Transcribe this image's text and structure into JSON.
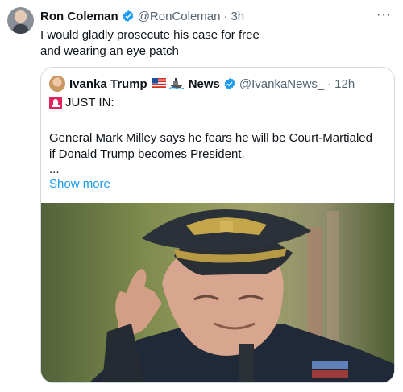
{
  "tweet": {
    "author_name": "Ron Coleman",
    "handle": "@RonColeman",
    "dot": "·",
    "time": "3h",
    "more": "···",
    "text_lines": [
      "I would gladly prosecute his case for free",
      "and wearing an eye patch"
    ]
  },
  "quote": {
    "author_name": "Ivanka Trump",
    "news_label": "News",
    "handle": "@IvankaNews_",
    "dot": "·",
    "time": "12h",
    "just_in": "JUST IN:",
    "para_lines": [
      "General Mark Milley says he fears he will be Court-Martialed",
      "if Donald Trump becomes President."
    ],
    "ellipsis": "...",
    "show_more": "Show more"
  },
  "colors": {
    "accent": "#1d9bf0",
    "secondary_text": "#536471",
    "border": "#cfd9de"
  },
  "icons": [
    "verified-badge-icon",
    "us-flag-icon",
    "ship-icon",
    "siren-icon",
    "more-icon"
  ]
}
